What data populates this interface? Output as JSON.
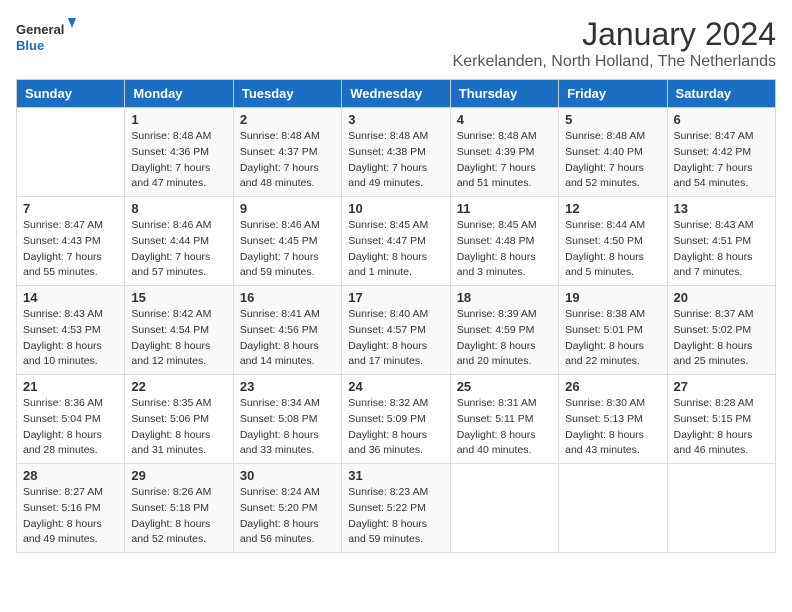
{
  "header": {
    "logo_general": "General",
    "logo_blue": "Blue",
    "main_title": "January 2024",
    "subtitle": "Kerkelanden, North Holland, The Netherlands"
  },
  "calendar": {
    "days_of_week": [
      "Sunday",
      "Monday",
      "Tuesday",
      "Wednesday",
      "Thursday",
      "Friday",
      "Saturday"
    ],
    "weeks": [
      [
        {
          "day": "",
          "info": ""
        },
        {
          "day": "1",
          "info": "Sunrise: 8:48 AM\nSunset: 4:36 PM\nDaylight: 7 hours\nand 47 minutes."
        },
        {
          "day": "2",
          "info": "Sunrise: 8:48 AM\nSunset: 4:37 PM\nDaylight: 7 hours\nand 48 minutes."
        },
        {
          "day": "3",
          "info": "Sunrise: 8:48 AM\nSunset: 4:38 PM\nDaylight: 7 hours\nand 49 minutes."
        },
        {
          "day": "4",
          "info": "Sunrise: 8:48 AM\nSunset: 4:39 PM\nDaylight: 7 hours\nand 51 minutes."
        },
        {
          "day": "5",
          "info": "Sunrise: 8:48 AM\nSunset: 4:40 PM\nDaylight: 7 hours\nand 52 minutes."
        },
        {
          "day": "6",
          "info": "Sunrise: 8:47 AM\nSunset: 4:42 PM\nDaylight: 7 hours\nand 54 minutes."
        }
      ],
      [
        {
          "day": "7",
          "info": "Sunrise: 8:47 AM\nSunset: 4:43 PM\nDaylight: 7 hours\nand 55 minutes."
        },
        {
          "day": "8",
          "info": "Sunrise: 8:46 AM\nSunset: 4:44 PM\nDaylight: 7 hours\nand 57 minutes."
        },
        {
          "day": "9",
          "info": "Sunrise: 8:46 AM\nSunset: 4:45 PM\nDaylight: 7 hours\nand 59 minutes."
        },
        {
          "day": "10",
          "info": "Sunrise: 8:45 AM\nSunset: 4:47 PM\nDaylight: 8 hours\nand 1 minute."
        },
        {
          "day": "11",
          "info": "Sunrise: 8:45 AM\nSunset: 4:48 PM\nDaylight: 8 hours\nand 3 minutes."
        },
        {
          "day": "12",
          "info": "Sunrise: 8:44 AM\nSunset: 4:50 PM\nDaylight: 8 hours\nand 5 minutes."
        },
        {
          "day": "13",
          "info": "Sunrise: 8:43 AM\nSunset: 4:51 PM\nDaylight: 8 hours\nand 7 minutes."
        }
      ],
      [
        {
          "day": "14",
          "info": "Sunrise: 8:43 AM\nSunset: 4:53 PM\nDaylight: 8 hours\nand 10 minutes."
        },
        {
          "day": "15",
          "info": "Sunrise: 8:42 AM\nSunset: 4:54 PM\nDaylight: 8 hours\nand 12 minutes."
        },
        {
          "day": "16",
          "info": "Sunrise: 8:41 AM\nSunset: 4:56 PM\nDaylight: 8 hours\nand 14 minutes."
        },
        {
          "day": "17",
          "info": "Sunrise: 8:40 AM\nSunset: 4:57 PM\nDaylight: 8 hours\nand 17 minutes."
        },
        {
          "day": "18",
          "info": "Sunrise: 8:39 AM\nSunset: 4:59 PM\nDaylight: 8 hours\nand 20 minutes."
        },
        {
          "day": "19",
          "info": "Sunrise: 8:38 AM\nSunset: 5:01 PM\nDaylight: 8 hours\nand 22 minutes."
        },
        {
          "day": "20",
          "info": "Sunrise: 8:37 AM\nSunset: 5:02 PM\nDaylight: 8 hours\nand 25 minutes."
        }
      ],
      [
        {
          "day": "21",
          "info": "Sunrise: 8:36 AM\nSunset: 5:04 PM\nDaylight: 8 hours\nand 28 minutes."
        },
        {
          "day": "22",
          "info": "Sunrise: 8:35 AM\nSunset: 5:06 PM\nDaylight: 8 hours\nand 31 minutes."
        },
        {
          "day": "23",
          "info": "Sunrise: 8:34 AM\nSunset: 5:08 PM\nDaylight: 8 hours\nand 33 minutes."
        },
        {
          "day": "24",
          "info": "Sunrise: 8:32 AM\nSunset: 5:09 PM\nDaylight: 8 hours\nand 36 minutes."
        },
        {
          "day": "25",
          "info": "Sunrise: 8:31 AM\nSunset: 5:11 PM\nDaylight: 8 hours\nand 40 minutes."
        },
        {
          "day": "26",
          "info": "Sunrise: 8:30 AM\nSunset: 5:13 PM\nDaylight: 8 hours\nand 43 minutes."
        },
        {
          "day": "27",
          "info": "Sunrise: 8:28 AM\nSunset: 5:15 PM\nDaylight: 8 hours\nand 46 minutes."
        }
      ],
      [
        {
          "day": "28",
          "info": "Sunrise: 8:27 AM\nSunset: 5:16 PM\nDaylight: 8 hours\nand 49 minutes."
        },
        {
          "day": "29",
          "info": "Sunrise: 8:26 AM\nSunset: 5:18 PM\nDaylight: 8 hours\nand 52 minutes."
        },
        {
          "day": "30",
          "info": "Sunrise: 8:24 AM\nSunset: 5:20 PM\nDaylight: 8 hours\nand 56 minutes."
        },
        {
          "day": "31",
          "info": "Sunrise: 8:23 AM\nSunset: 5:22 PM\nDaylight: 8 hours\nand 59 minutes."
        },
        {
          "day": "",
          "info": ""
        },
        {
          "day": "",
          "info": ""
        },
        {
          "day": "",
          "info": ""
        }
      ]
    ]
  }
}
